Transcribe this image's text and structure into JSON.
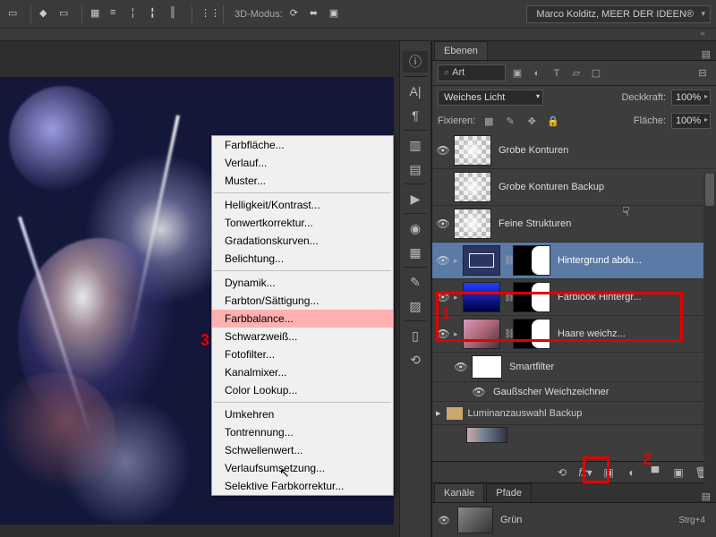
{
  "topbar": {
    "mode_label": "3D-Modus:",
    "user": "Marco Kolditz, MEER DER IDEEN®"
  },
  "context_menu": {
    "groups": [
      [
        "Farbfläche...",
        "Verlauf...",
        "Muster..."
      ],
      [
        "Helligkeit/Kontrast...",
        "Tonwertkorrektur...",
        "Gradationskurven...",
        "Belichtung..."
      ],
      [
        "Dynamik...",
        "Farbton/Sättigung...",
        "Farbbalance...",
        "Schwarzweiß...",
        "Fotofilter...",
        "Kanalmixer...",
        "Color Lookup..."
      ],
      [
        "Umkehren",
        "Tontrennung...",
        "Schwellenwert...",
        "Verlaufsumsetzung...",
        "Selektive Farbkorrektur..."
      ]
    ],
    "highlighted_index": [
      2,
      2
    ]
  },
  "callouts": {
    "one": "1",
    "two": "2",
    "three": "3"
  },
  "panels": {
    "layers_tab": "Ebenen",
    "search_label": "Art",
    "blend_mode": "Weiches Licht",
    "opacity_label": "Deckkraft:",
    "opacity_value": "100%",
    "lock_label": "Fixieren:",
    "fill_label": "Fläche:",
    "fill_value": "100%",
    "layers": [
      {
        "name": "Grobe Konturen",
        "visible": true,
        "checker": true
      },
      {
        "name": "Grobe Konturen Backup",
        "visible": false,
        "checker": true
      },
      {
        "name": "Feine Strukturen",
        "visible": true,
        "checker": true
      },
      {
        "name": "Hintergrund abdu...",
        "visible": true,
        "selected": true,
        "adjust": true,
        "mask": true
      },
      {
        "name": "Farblook Hintergr...",
        "visible": true,
        "gradient": true,
        "mask": true
      },
      {
        "name": "Haare weichz...",
        "visible": true,
        "photo": true,
        "mask": true,
        "fx": true
      }
    ],
    "smartfilter_label": "Smartfilter",
    "gauss_label": "Gaußscher Weichzeichner",
    "group_label": "Luminanzauswahl Backup",
    "channels_tab": "Kanäle",
    "paths_tab": "Pfade",
    "channel_name": "Grün",
    "channel_shortcut": "Strg+4"
  }
}
